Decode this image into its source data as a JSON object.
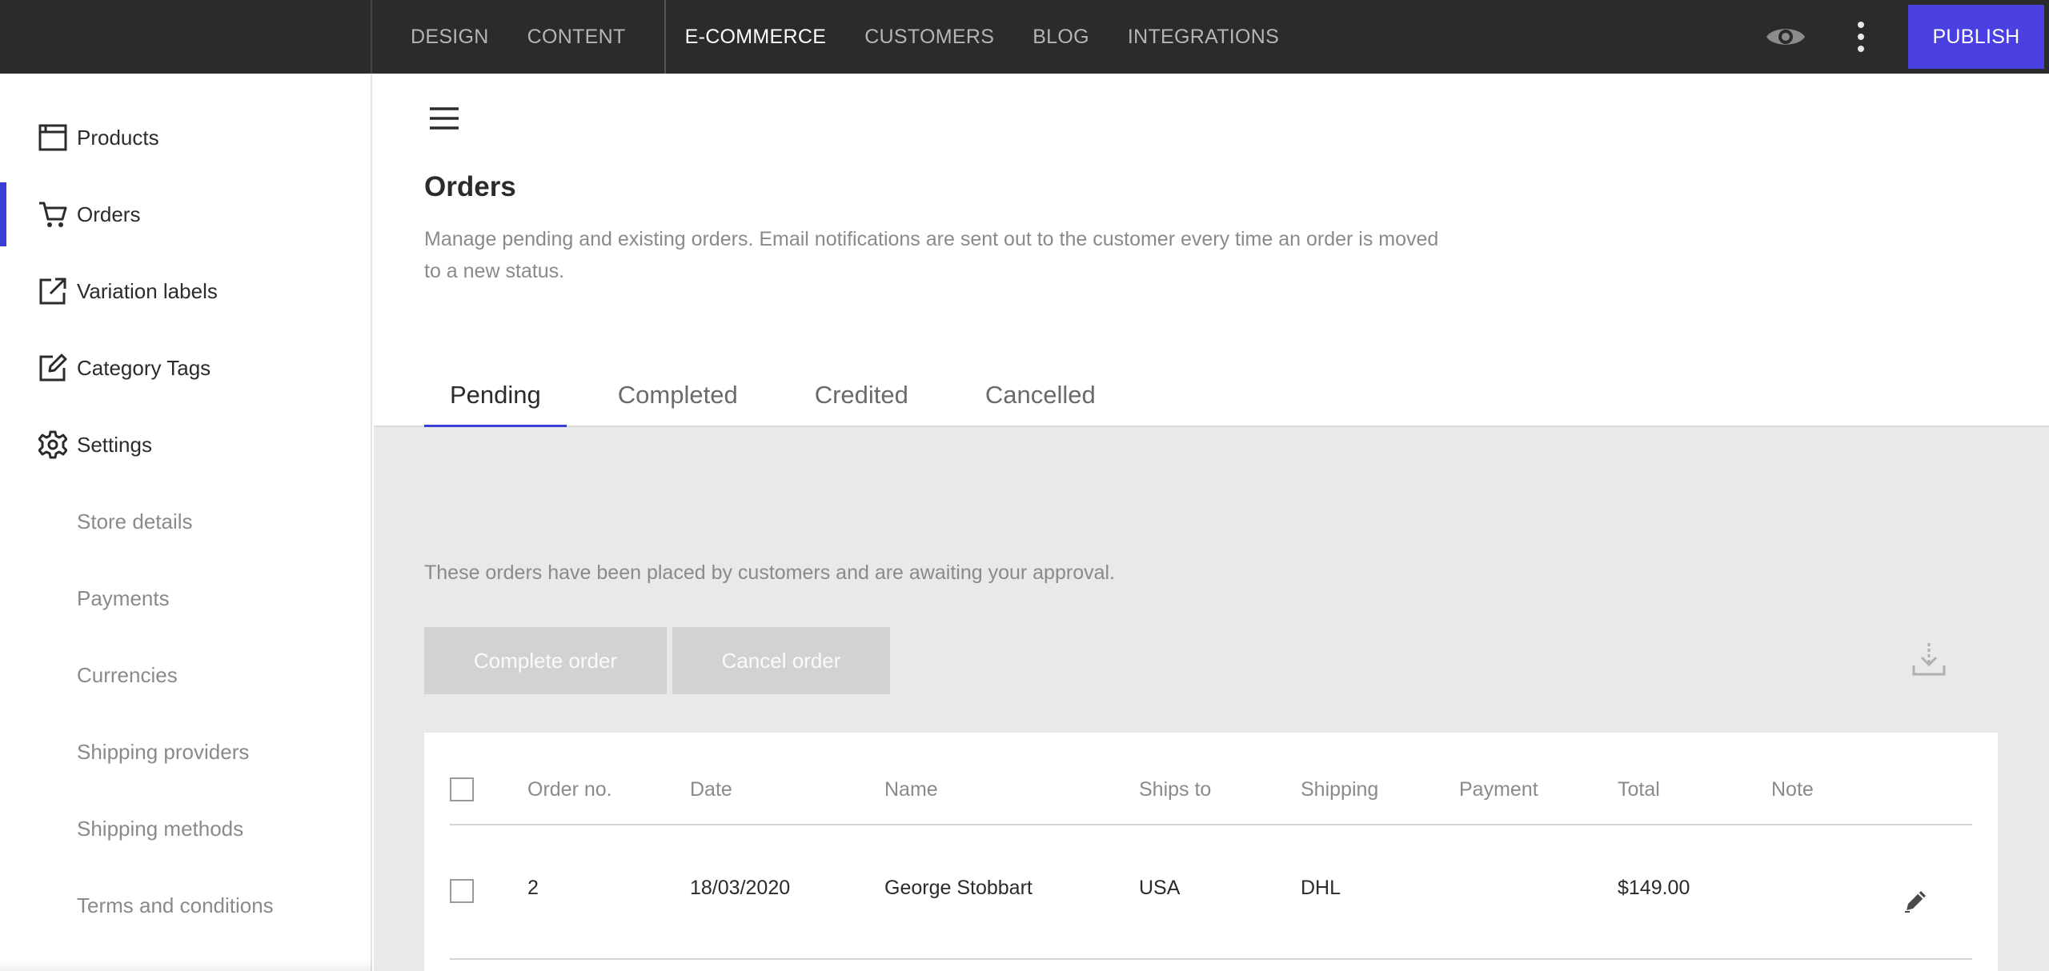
{
  "topnav": {
    "items": [
      {
        "label": "DESIGN"
      },
      {
        "label": "CONTENT"
      },
      {
        "label": "E-COMMERCE"
      },
      {
        "label": "CUSTOMERS"
      },
      {
        "label": "BLOG"
      },
      {
        "label": "INTEGRATIONS"
      }
    ],
    "active": "E-COMMERCE",
    "preview_icon": "eye-icon",
    "more_icon": "kebab-menu-icon",
    "publish_label": "PUBLISH",
    "accent_color": "#4a3fe0"
  },
  "sidebar": {
    "items": [
      {
        "label": "Products",
        "icon": "browser-window-icon"
      },
      {
        "label": "Orders",
        "icon": "cart-icon",
        "active": true
      },
      {
        "label": "Variation labels",
        "icon": "external-link-icon"
      },
      {
        "label": "Category Tags",
        "icon": "edit-square-icon"
      },
      {
        "label": "Settings",
        "icon": "gear-icon"
      }
    ],
    "subitems": [
      {
        "label": "Store details"
      },
      {
        "label": "Payments"
      },
      {
        "label": "Currencies"
      },
      {
        "label": "Shipping providers"
      },
      {
        "label": "Shipping methods"
      },
      {
        "label": "Terms and conditions"
      }
    ],
    "active_color": "#3a3fd4"
  },
  "main": {
    "menu_icon": "hamburger-icon",
    "title": "Orders",
    "description": "Manage pending and existing orders. Email notifications are sent out to the customer every time an order is moved to a new status.",
    "tabs": [
      {
        "label": "Pending"
      },
      {
        "label": "Completed"
      },
      {
        "label": "Credited"
      },
      {
        "label": "Cancelled"
      }
    ],
    "active_tab": "Pending",
    "intro": "These orders have been placed by customers and are awaiting your approval.",
    "complete_label": "Complete order",
    "cancel_label": "Cancel order",
    "download_icon": "download-icon"
  },
  "table": {
    "columns": [
      "Order no.",
      "Date",
      "Name",
      "Ships to",
      "Shipping",
      "Payment",
      "Total",
      "Note"
    ],
    "rows": [
      {
        "order_no": "2",
        "date": "18/03/2020",
        "name": "George Stobbart",
        "ships_to": "USA",
        "shipping": "DHL",
        "payment": "",
        "total": "$149.00",
        "note": ""
      }
    ],
    "edit_icon": "pencil-icon"
  }
}
